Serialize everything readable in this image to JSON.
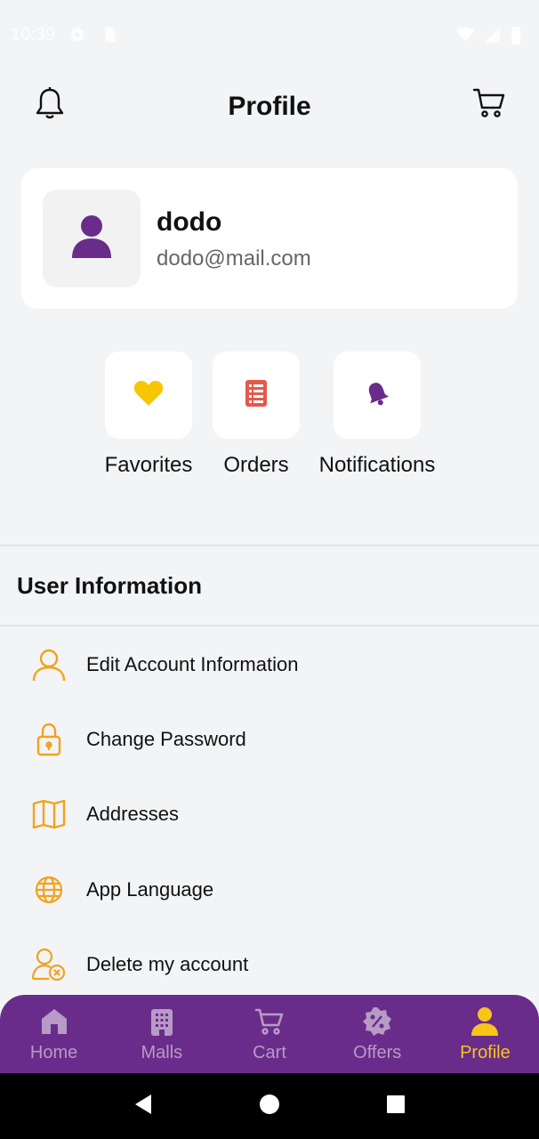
{
  "status_bar": {
    "time": "10:39",
    "icons": [
      "settings-icon",
      "sdcard-icon",
      "wifi-icon",
      "signal-icon",
      "battery-icon"
    ]
  },
  "header": {
    "title": "Profile",
    "left_icon": "bell-icon",
    "right_icon": "cart-icon"
  },
  "profile": {
    "name": "dodo",
    "email": "dodo@mail.com",
    "avatar_icon": "user-icon"
  },
  "quick_actions": [
    {
      "label": "Favorites",
      "icon": "heart-icon",
      "color": "#f7c600"
    },
    {
      "label": "Orders",
      "icon": "list-icon",
      "color": "#e35a4b"
    },
    {
      "label": "Notifications",
      "icon": "bell-icon",
      "color": "#6a2c8a"
    }
  ],
  "section": {
    "title": "User Information"
  },
  "menu": [
    {
      "label": "Edit Account Information",
      "icon": "user-outline-icon"
    },
    {
      "label": "Change Password",
      "icon": "lock-icon"
    },
    {
      "label": "Addresses",
      "icon": "map-icon"
    },
    {
      "label": "App Language",
      "icon": "globe-icon"
    },
    {
      "label": "Delete my account",
      "icon": "user-delete-icon"
    }
  ],
  "bottom_nav": {
    "items": [
      {
        "label": "Home",
        "icon": "home-icon",
        "active": false
      },
      {
        "label": "Malls",
        "icon": "building-icon",
        "active": false
      },
      {
        "label": "Cart",
        "icon": "cart-icon",
        "active": false
      },
      {
        "label": "Offers",
        "icon": "percent-badge-icon",
        "active": false
      },
      {
        "label": "Profile",
        "icon": "user-icon",
        "active": true
      }
    ]
  },
  "colors": {
    "brand_purple": "#6a2c8a",
    "accent_yellow": "#f7c41a",
    "icon_orange": "#f2a21e",
    "background": "#f3f4f6"
  }
}
